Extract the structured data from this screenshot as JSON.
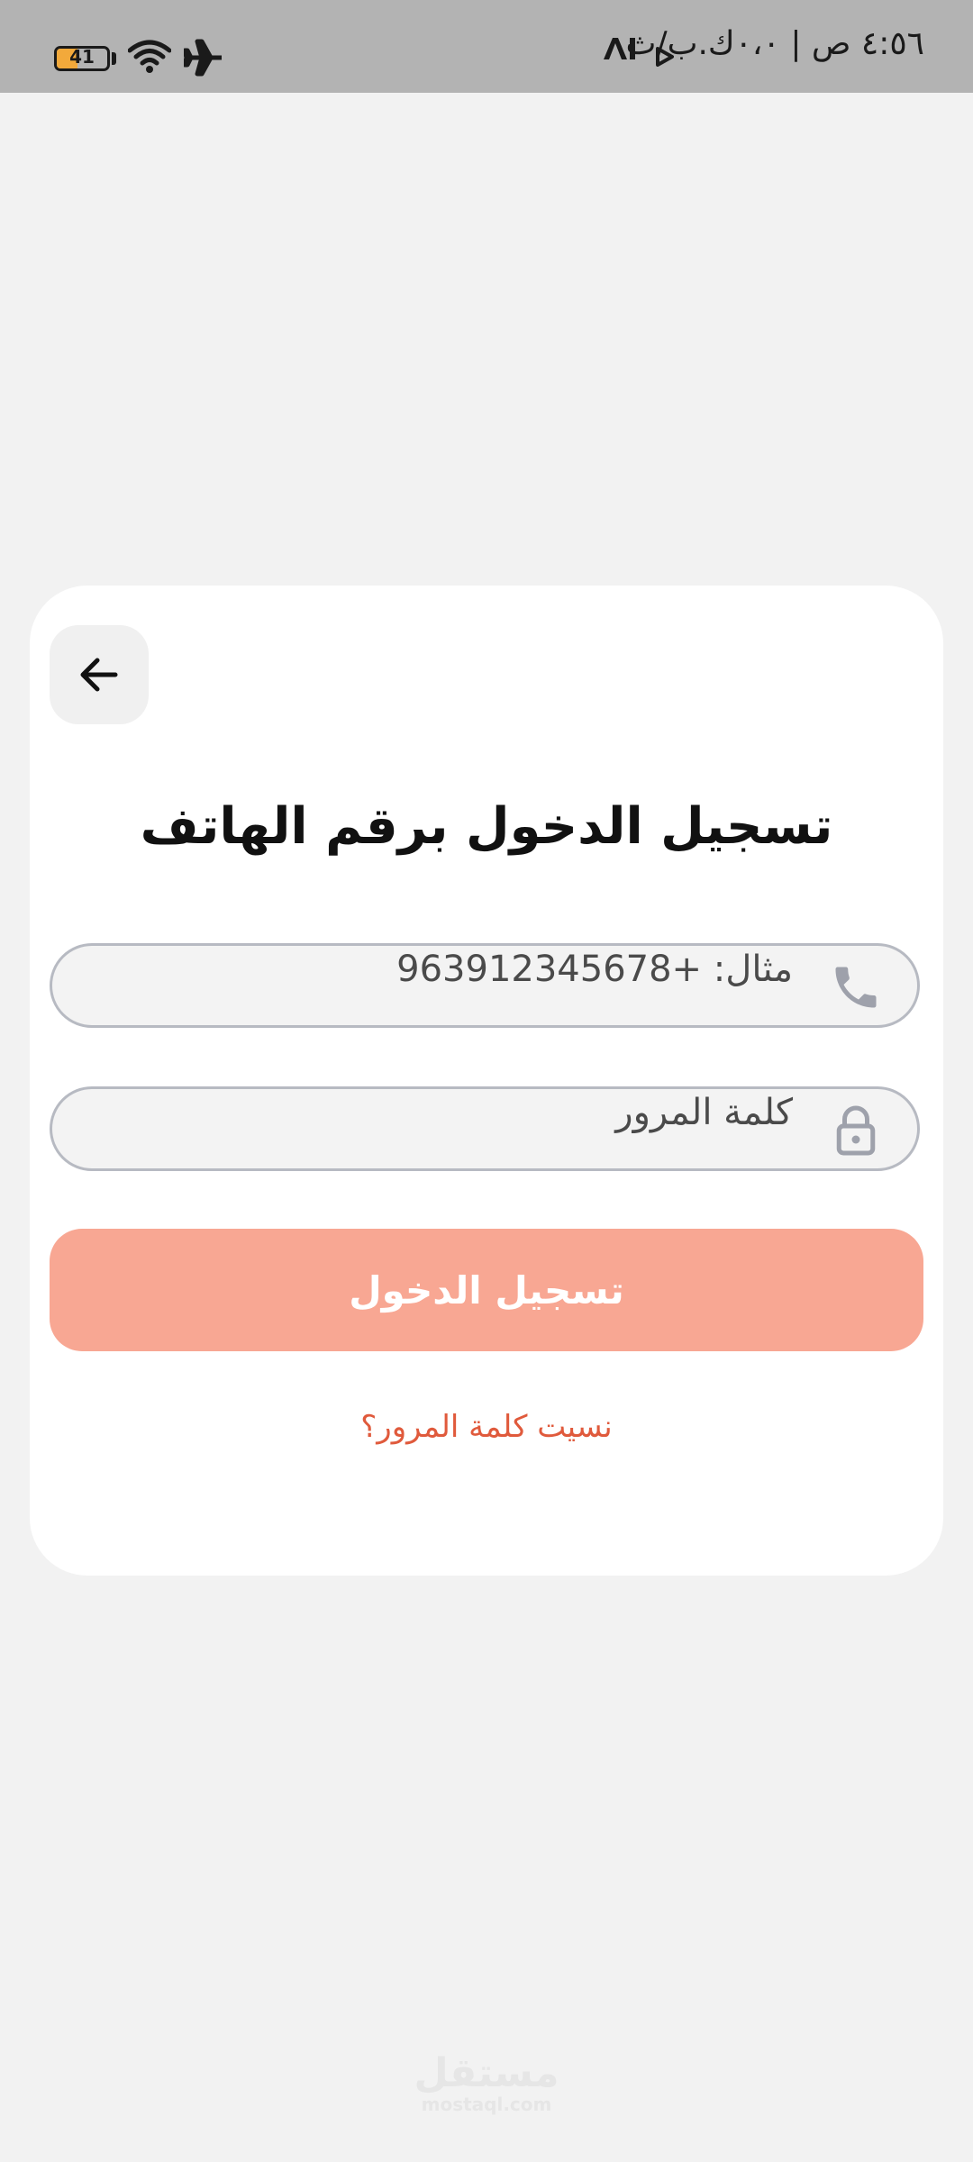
{
  "status_bar": {
    "time": "٤:٥٦ ص | ٠،٠ك.ب/ث",
    "ai_label": "AI",
    "battery_level": "41",
    "battery_fraction": 0.41,
    "icons": [
      "play-icon",
      "wifi-icon",
      "airplane-icon"
    ]
  },
  "card": {
    "title": "تسجيل الدخول برقم الهاتف",
    "phone_field": {
      "placeholder": "مثال: +963912345678",
      "icon": "phone-icon"
    },
    "password_field": {
      "placeholder": "كلمة المرور",
      "icon": "lock-icon"
    },
    "login_button": "تسجيل الدخول",
    "forgot_link": "نسيت كلمة المرور؟",
    "back_icon": "arrow-left-icon"
  },
  "footer": {
    "logo_arabic": "مستقل",
    "logo_latin": "mostaql.com"
  },
  "colors": {
    "background": "#f2f2f2",
    "status_bar": "#b3b3b3",
    "card": "#ffffff",
    "button": "#f8a793",
    "link": "#e05a3c",
    "field_border": "#b7bac2"
  }
}
